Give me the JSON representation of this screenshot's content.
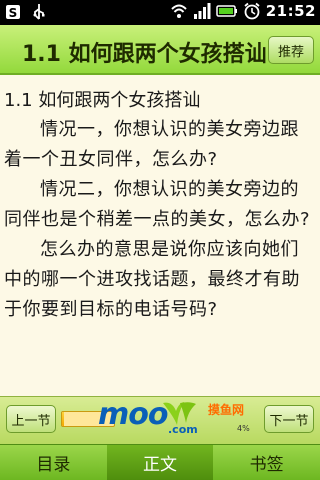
{
  "status_bar": {
    "time": "21:52",
    "icons": [
      "notification-icon",
      "usb-icon",
      "wifi-icon",
      "signal-icon",
      "battery-icon",
      "alarm-icon"
    ]
  },
  "title_bar": {
    "title": "1.1 如何跟两个女孩搭讪",
    "recommend_label": "推荐"
  },
  "content": {
    "heading": "1.1 如何跟两个女孩搭讪",
    "paragraphs": [
      "情况一，你想认识的美女旁边跟着一个丑女同伴，怎么办?",
      "情况二，你想认识的美女旁边的同伴也是个稍差一点的美女，怎么办?",
      "怎么办的意思是说你应该向她们中的哪一个进攻找话题，最终才有助于你要到目标的电话号码?"
    ]
  },
  "nav": {
    "prev_label": "上一节",
    "next_label": "下一节",
    "progress_percent": 4,
    "progress_text": "4%",
    "ad_logo": "moo",
    "ad_dotcom": ".com",
    "ad_cn": "摸鱼网"
  },
  "tabs": [
    {
      "label": "目录",
      "active": false
    },
    {
      "label": "正文",
      "active": true
    },
    {
      "label": "书签",
      "active": false
    }
  ],
  "colors": {
    "title_bar": "#a8e04c",
    "active_tab": "#5a9c14",
    "background": "#fdf9e6"
  }
}
